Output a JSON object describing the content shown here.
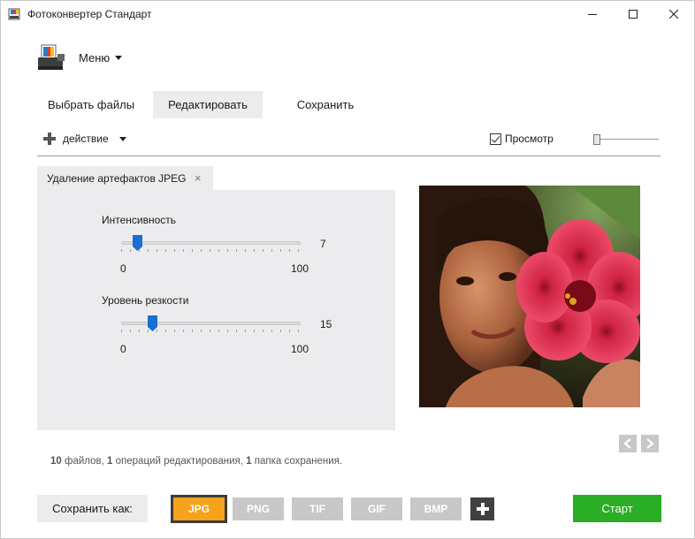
{
  "window": {
    "title": "Фотоконвертер Стандарт",
    "icons": {
      "app": "app-icon",
      "minimize": "minimize-icon",
      "maximize": "maximize-icon",
      "close": "close-icon"
    }
  },
  "menu": {
    "label": "Меню",
    "icon": "chevron-down-icon"
  },
  "tabs": [
    {
      "label": "Выбрать файлы",
      "active": false
    },
    {
      "label": "Редактировать",
      "active": true
    },
    {
      "label": "Сохранить",
      "active": false
    }
  ],
  "toolbar": {
    "add_action_label": "действие",
    "preview_label": "Просмотр",
    "preview_checked": true,
    "zoom_level": 0
  },
  "operation": {
    "tab_label": "Удаление артефактов JPEG",
    "close_glyph": "×",
    "params": [
      {
        "label": "Интенсивность",
        "value": "7",
        "min": "0",
        "max": "100"
      },
      {
        "label": "Уровень резкости",
        "value": "15",
        "min": "0",
        "max": "100"
      }
    ]
  },
  "summary": {
    "files_count": "10",
    "files_label": "файлов,",
    "ops_count": "1",
    "ops_label": "операций редактирования,",
    "folders_count": "1",
    "folders_label": "папка сохранения."
  },
  "bottom": {
    "save_as_label": "Сохранить как:",
    "formats": [
      "JPG",
      "PNG",
      "TIF",
      "GIF",
      "BMP"
    ],
    "active_format": "JPG",
    "start_label": "Старт"
  },
  "colors": {
    "accent_orange": "#f7a21b",
    "start_green": "#2aae25",
    "slider_thumb": "#1a6fd1",
    "panel_bg": "#ececee"
  }
}
